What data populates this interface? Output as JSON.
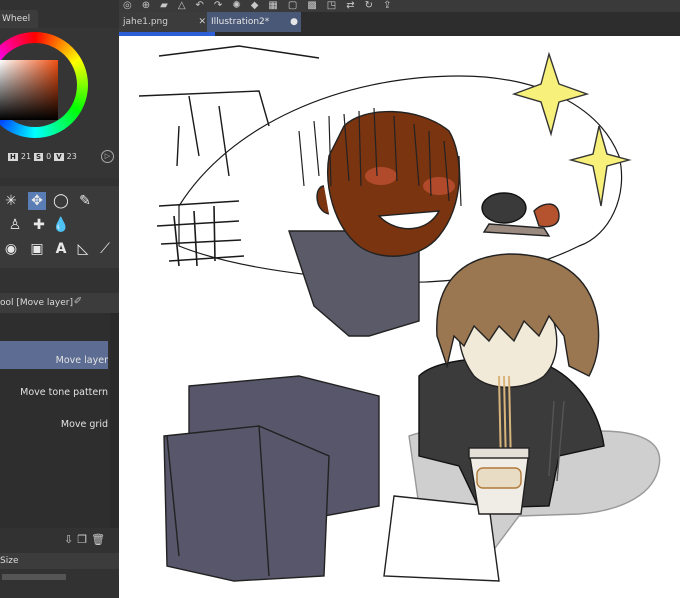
{
  "color_panel": {
    "tab_label": "Wheel",
    "hsv": [
      {
        "key": "H",
        "value": "21"
      },
      {
        "key": "S",
        "value": "0"
      },
      {
        "key": "V",
        "value": "23"
      }
    ],
    "ring_colors": [
      "#ff0000",
      "#ffff00",
      "#00ff00",
      "#00ffff",
      "#0000ff",
      "#ff00ff"
    ],
    "main_color": "#f04f12"
  },
  "tool_palette": {
    "selected_tool": "move-icon",
    "icons": [
      "sparkle-icon",
      "move-icon",
      "lasso-icon",
      "eyedropper-icon",
      "pen-icon",
      "fill-icon",
      "fill-bucket-icon",
      "spiral-icon",
      "layer-frame-icon",
      "text-icon",
      "triangle-ruler-icon",
      "brush-icon"
    ]
  },
  "sub_tool": {
    "header": "ool [Move layer]",
    "items": [
      {
        "label": "Move layer"
      },
      {
        "label": "Move tone pattern"
      },
      {
        "label": "Move grid"
      }
    ]
  },
  "properties": {
    "header": "Size"
  },
  "document_tabs": [
    {
      "label": "jahe1.png"
    },
    {
      "label": "Illustration2*"
    }
  ],
  "accent_color": "#2c5fd6"
}
